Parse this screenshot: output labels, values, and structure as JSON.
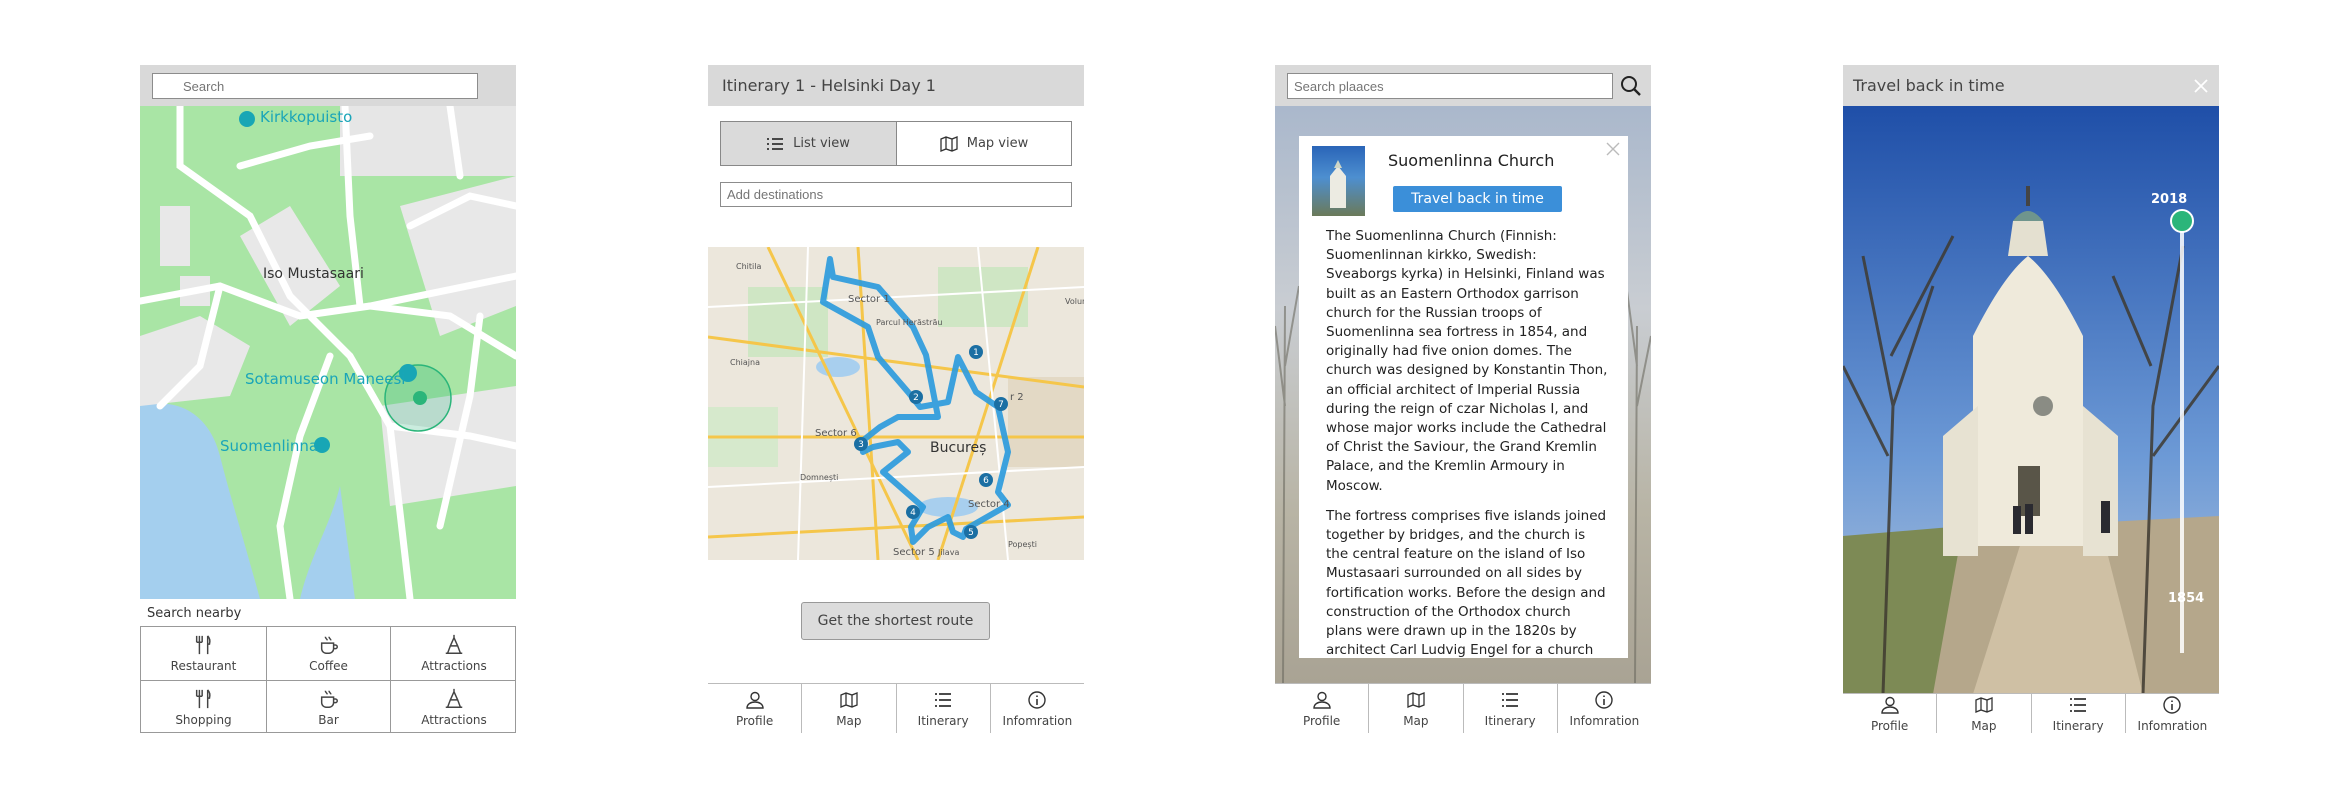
{
  "screen1": {
    "search_placeholder": "Search",
    "map_labels": {
      "kirkkopuisto": "Kirkkopuisto",
      "iso_mustasaari": "Iso Mustasaari",
      "sotamuseon": "Sotamuseon Maneesi",
      "suomenlinna": "Suomenlinna"
    },
    "search_nearby_label": "Search nearby",
    "categories": [
      {
        "label": "Restaurant",
        "icon": "fork-knife-icon"
      },
      {
        "label": "Coffee",
        "icon": "coffee-cup-icon"
      },
      {
        "label": "Attractions",
        "icon": "landmark-icon"
      },
      {
        "label": "Shopping",
        "icon": "fork-knife-icon"
      },
      {
        "label": "Bar",
        "icon": "coffee-cup-icon"
      },
      {
        "label": "Attractions",
        "icon": "landmark-icon"
      }
    ]
  },
  "screen2": {
    "title": "Itinerary 1 - Helsinki Day 1",
    "list_view_label": "List view",
    "map_view_label": "Map view",
    "add_destinations_placeholder": "Add destinations",
    "map_labels": {
      "chitila": "Chitila",
      "sector1": "Sector 1",
      "parcul_herastrau": "Parcul Herăstrău",
      "voluntari": "Volun",
      "chiajna": "Chiajna",
      "sector2": "r 2",
      "sector6": "Sector 6",
      "bucuresti": "Bucureș",
      "domnesti": "Domnești",
      "sector4": "Sector 4",
      "sector5": "Sector 5",
      "jilava": "Jilava",
      "popesti": "Popești"
    },
    "route_stops": [
      "1",
      "2",
      "3",
      "4",
      "5",
      "6",
      "7"
    ],
    "shortest_route_label": "Get the shortest route",
    "tabs": [
      "Profile",
      "Map",
      "Itinerary",
      "Infomration"
    ]
  },
  "screen3": {
    "search_placeholder": "Search plaaces",
    "church_name": "Suomenlinna Church",
    "travel_button_label": "Travel back in time",
    "paragraph1": "The Suomenlinna Church (Finnish: Suomenlinnan kirkko, Swedish: Sveaborgs kyrka) in Helsinki, Finland was built as an Eastern Orthodox garrison church for the Russian troops of Suomenlinna sea fortress in 1854, and originally had five onion domes. The church was designed by Konstantin Thon, an official architect of Imperial Russia during the reign of czar Nicholas I, and whose major works include the Cathedral of Christ the Saviour, the Grand Kremlin Palace, and the Kremlin Armoury in Moscow.",
    "paragraph2": "The fortress comprises five islands joined together by bridges, and the church is the central feature on the island of Iso Mustasaari surrounded on all sides by fortification works. Before the design and construction of the Orthodox church plans were drawn up in the 1820s by architect Carl Ludvig Engel for a church on the same site, but designed in the neoclassical style,",
    "tabs": [
      "Profile",
      "Map",
      "Itinerary",
      "Infomration"
    ]
  },
  "screen4": {
    "title": "Travel back in time",
    "year_top": "2018",
    "year_bottom": "1854",
    "timeline_level": 0,
    "tabs": [
      "Profile",
      "Map",
      "Itinerary",
      "Infomration"
    ]
  },
  "colors": {
    "header_gray": "#d9d9d9",
    "map_green": "#a9e5a5",
    "map_water": "#a4cfee",
    "accent_teal": "#2bb57a",
    "route_blue": "#2d9bdc",
    "button_blue": "#3b8fd9"
  }
}
